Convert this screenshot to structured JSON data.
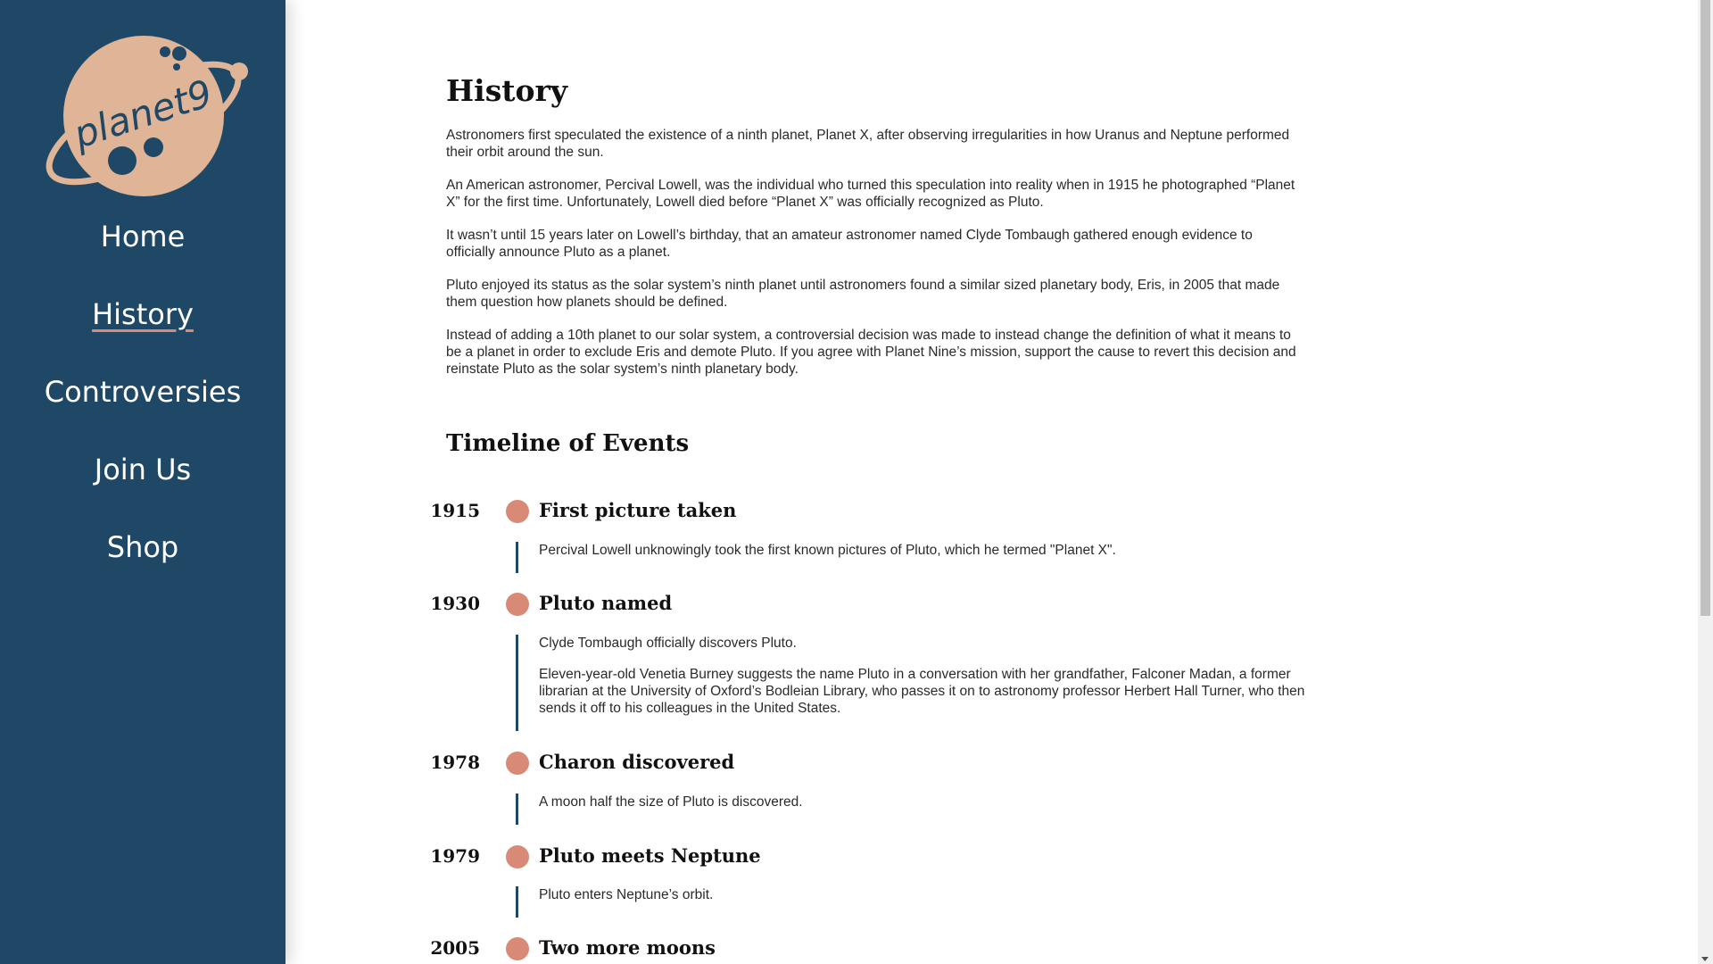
{
  "brand": {
    "logo_text": "planet9",
    "logo_color": "#e0b497",
    "sidebar_color": "#1e4866",
    "accent": "#d88a77"
  },
  "nav": {
    "items": [
      {
        "label": "Home"
      },
      {
        "label": "History",
        "active": true
      },
      {
        "label": "Controversies"
      },
      {
        "label": "Join Us"
      },
      {
        "label": "Shop"
      }
    ]
  },
  "history": {
    "title": "History",
    "paragraphs": [
      "Astronomers first speculated the existence of a ninth planet, Planet X, after observing irregularities in how Uranus and Neptune performed their orbit around the sun.",
      "An American astronomer, Percival Lowell, was the individual who turned this speculation into reality when in 1915 he photographed “Planet X” for the first time. Unfortunately, Lowell died before “Planet X” was officially recognized as Pluto.",
      "It wasn’t until 15 years later on Lowell’s birthday, that an amateur astronomer named Clyde Tombaugh gathered enough evidence to officially announce Pluto as a planet.",
      "Pluto enjoyed its status as the solar system’s ninth planet until astronomers found a similar sized planetary body, Eris, in 2005 that made them question how planets should be defined.",
      "Instead of adding a 10th planet to our solar system, a controversial decision was made to instead change the definition of what it means to be a planet in order to exclude Eris and demote Pluto. If you agree with Planet Nine’s mission, support the cause to revert this decision and reinstate Pluto as the solar system’s ninth planetary body."
    ]
  },
  "timeline": {
    "title": "Timeline of Events",
    "events": [
      {
        "year": "1915",
        "title": "First picture taken",
        "texts": [
          "Percival Lowell unknowingly took the first known pictures of Pluto, which he termed \"Planet X\"."
        ]
      },
      {
        "year": "1930",
        "title": "Pluto named",
        "texts": [
          "Clyde Tombaugh officially discovers Pluto.",
          "Eleven-year-old Venetia Burney suggests the name Pluto in a conversation with her grandfather, Falconer Madan, a former librarian at the University of Oxford’s Bodleian Library, who passes it on to astronomy professor Herbert Hall Turner, who then sends it off to his colleagues in the United States."
        ]
      },
      {
        "year": "1978",
        "title": "Charon discovered",
        "texts": [
          "A moon half the size of Pluto is discovered."
        ]
      },
      {
        "year": "1979",
        "title": "Pluto meets Neptune",
        "texts": [
          "Pluto enters Neptune’s orbit."
        ]
      },
      {
        "year": "2005",
        "title": "Two more moons",
        "texts": []
      }
    ]
  }
}
